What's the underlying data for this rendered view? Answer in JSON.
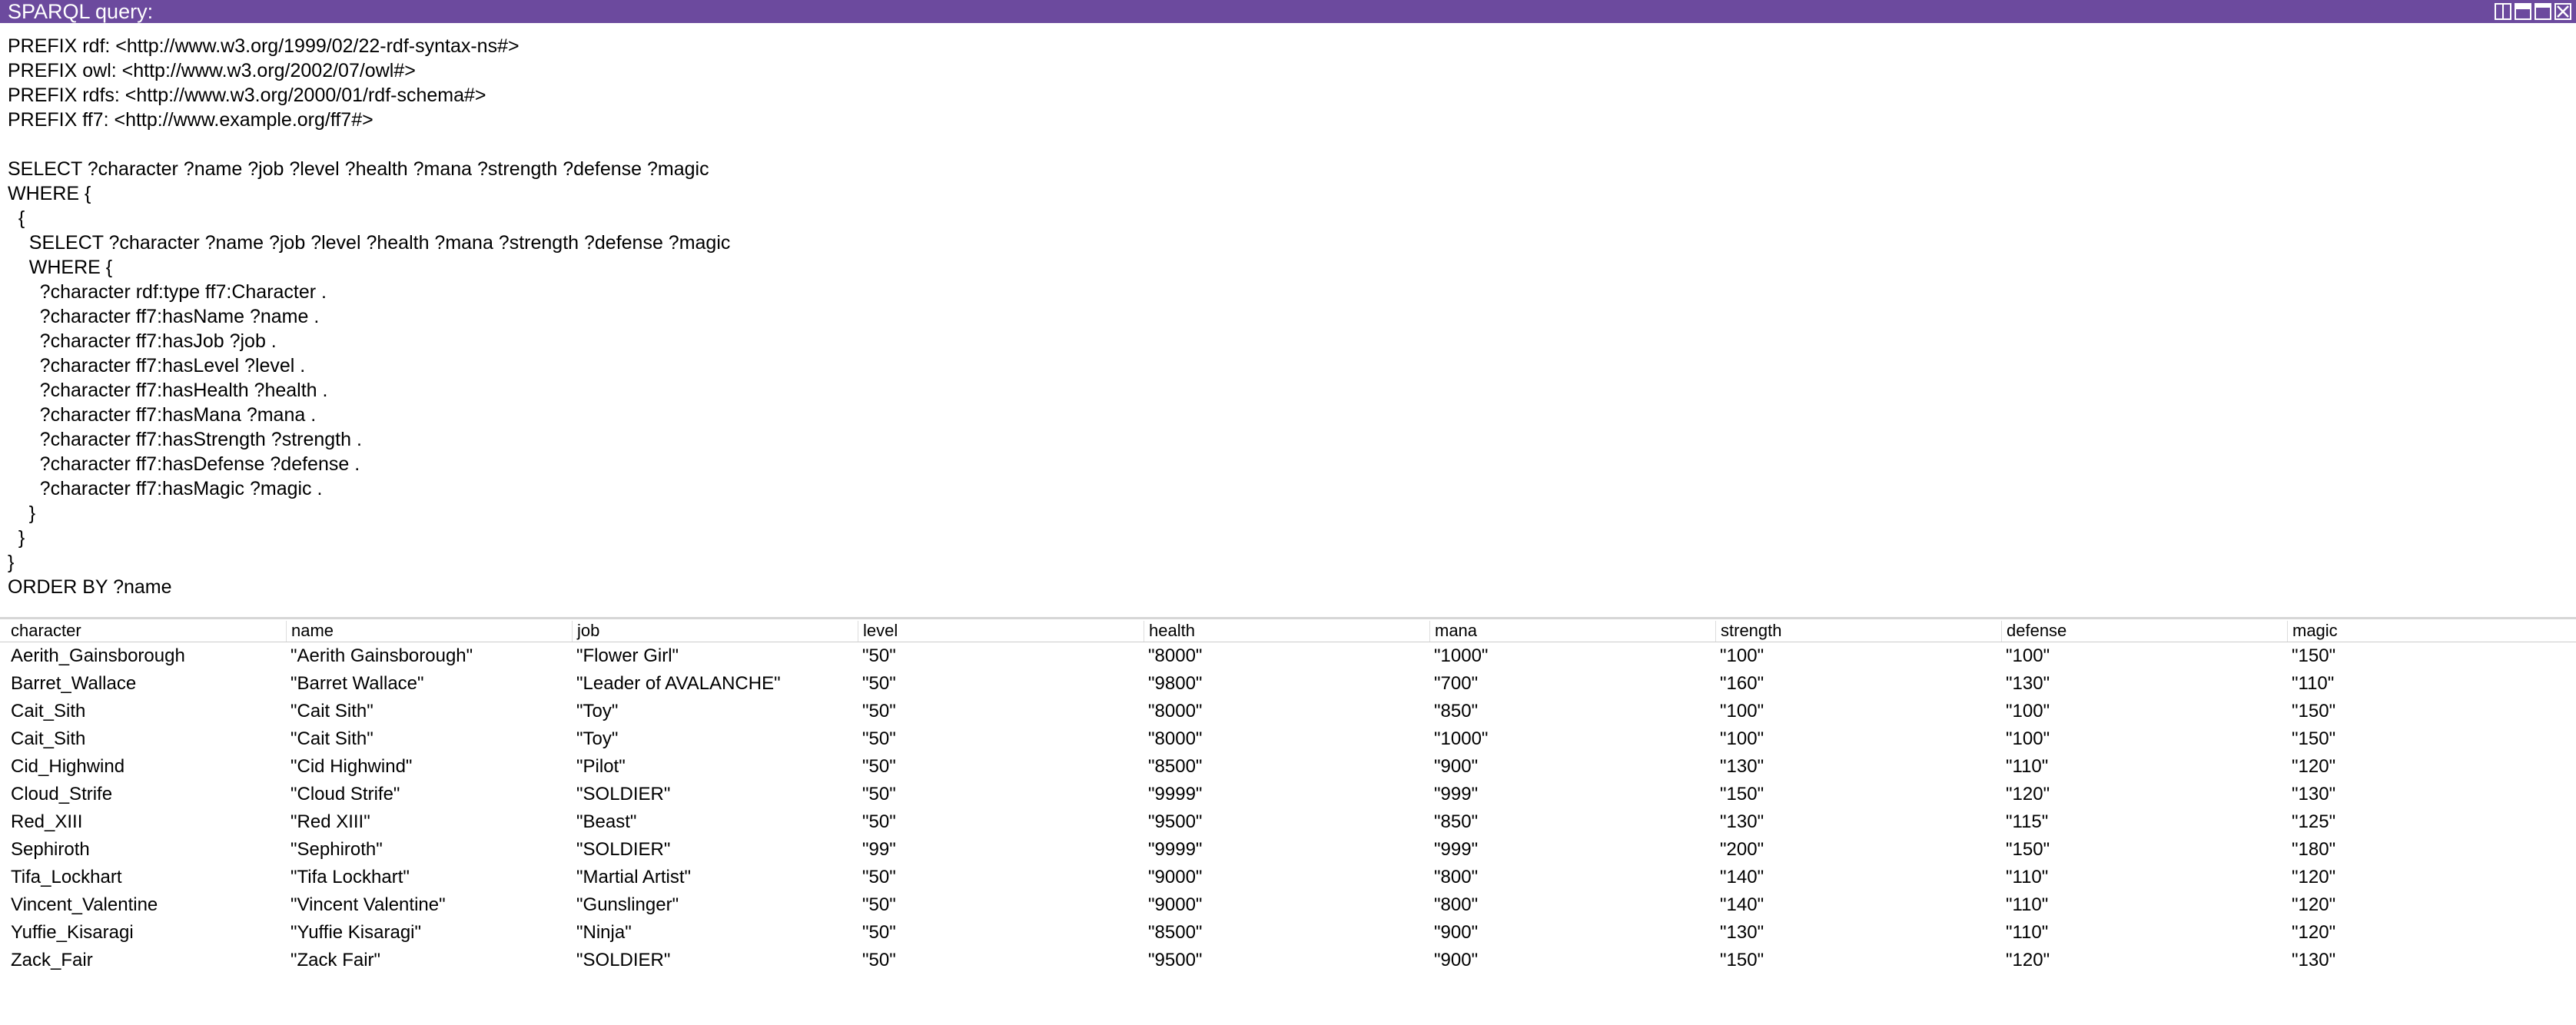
{
  "window": {
    "title": "SPARQL query:",
    "controls": [
      "split-view-icon",
      "minimize-icon",
      "maximize-icon",
      "close-icon"
    ],
    "title_bar_color": "#6c4a9e"
  },
  "query": {
    "lines": [
      "PREFIX rdf: <http://www.w3.org/1999/02/22-rdf-syntax-ns#>",
      "PREFIX owl: <http://www.w3.org/2002/07/owl#>",
      "PREFIX rdfs: <http://www.w3.org/2000/01/rdf-schema#>",
      "PREFIX ff7: <http://www.example.org/ff7#>",
      "",
      "SELECT ?character ?name ?job ?level ?health ?mana ?strength ?defense ?magic",
      "WHERE {",
      "  {",
      "    SELECT ?character ?name ?job ?level ?health ?mana ?strength ?defense ?magic",
      "    WHERE {",
      "      ?character rdf:type ff7:Character .",
      "      ?character ff7:hasName ?name .",
      "      ?character ff7:hasJob ?job .",
      "      ?character ff7:hasLevel ?level .",
      "      ?character ff7:hasHealth ?health .",
      "      ?character ff7:hasMana ?mana .",
      "      ?character ff7:hasStrength ?strength .",
      "      ?character ff7:hasDefense ?defense .",
      "      ?character ff7:hasMagic ?magic .",
      "    }",
      "  }",
      "}",
      "ORDER BY ?name"
    ]
  },
  "results": {
    "columns": [
      "character",
      "name",
      "job",
      "level",
      "health",
      "mana",
      "strength",
      "defense",
      "magic"
    ],
    "rows": [
      [
        "Aerith_Gainsborough",
        "\"Aerith Gainsborough\"",
        "\"Flower Girl\"",
        "\"50\"",
        "\"8000\"",
        "\"1000\"",
        "\"100\"",
        "\"100\"",
        "\"150\""
      ],
      [
        "Barret_Wallace",
        "\"Barret Wallace\"",
        "\"Leader of AVALANCHE\"",
        "\"50\"",
        "\"9800\"",
        "\"700\"",
        "\"160\"",
        "\"130\"",
        "\"110\""
      ],
      [
        "Cait_Sith",
        "\"Cait Sith\"",
        "\"Toy\"",
        "\"50\"",
        "\"8000\"",
        "\"850\"",
        "\"100\"",
        "\"100\"",
        "\"150\""
      ],
      [
        "Cait_Sith",
        "\"Cait Sith\"",
        "\"Toy\"",
        "\"50\"",
        "\"8000\"",
        "\"1000\"",
        "\"100\"",
        "\"100\"",
        "\"150\""
      ],
      [
        "Cid_Highwind",
        "\"Cid Highwind\"",
        "\"Pilot\"",
        "\"50\"",
        "\"8500\"",
        "\"900\"",
        "\"130\"",
        "\"110\"",
        "\"120\""
      ],
      [
        "Cloud_Strife",
        "\"Cloud Strife\"",
        "\"SOLDIER\"",
        "\"50\"",
        "\"9999\"",
        "\"999\"",
        "\"150\"",
        "\"120\"",
        "\"130\""
      ],
      [
        "Red_XIII",
        "\"Red XIII\"",
        "\"Beast\"",
        "\"50\"",
        "\"9500\"",
        "\"850\"",
        "\"130\"",
        "\"115\"",
        "\"125\""
      ],
      [
        "Sephiroth",
        "\"Sephiroth\"",
        "\"SOLDIER\"",
        "\"99\"",
        "\"9999\"",
        "\"999\"",
        "\"200\"",
        "\"150\"",
        "\"180\""
      ],
      [
        "Tifa_Lockhart",
        "\"Tifa Lockhart\"",
        "\"Martial Artist\"",
        "\"50\"",
        "\"9000\"",
        "\"800\"",
        "\"140\"",
        "\"110\"",
        "\"120\""
      ],
      [
        "Vincent_Valentine",
        "\"Vincent Valentine\"",
        "\"Gunslinger\"",
        "\"50\"",
        "\"9000\"",
        "\"800\"",
        "\"140\"",
        "\"110\"",
        "\"120\""
      ],
      [
        "Yuffie_Kisaragi",
        "\"Yuffie Kisaragi\"",
        "\"Ninja\"",
        "\"50\"",
        "\"8500\"",
        "\"900\"",
        "\"130\"",
        "\"110\"",
        "\"120\""
      ],
      [
        "Zack_Fair",
        "\"Zack Fair\"",
        "\"SOLDIER\"",
        "\"50\"",
        "\"9500\"",
        "\"900\"",
        "\"150\"",
        "\"120\"",
        "\"130\""
      ]
    ]
  }
}
